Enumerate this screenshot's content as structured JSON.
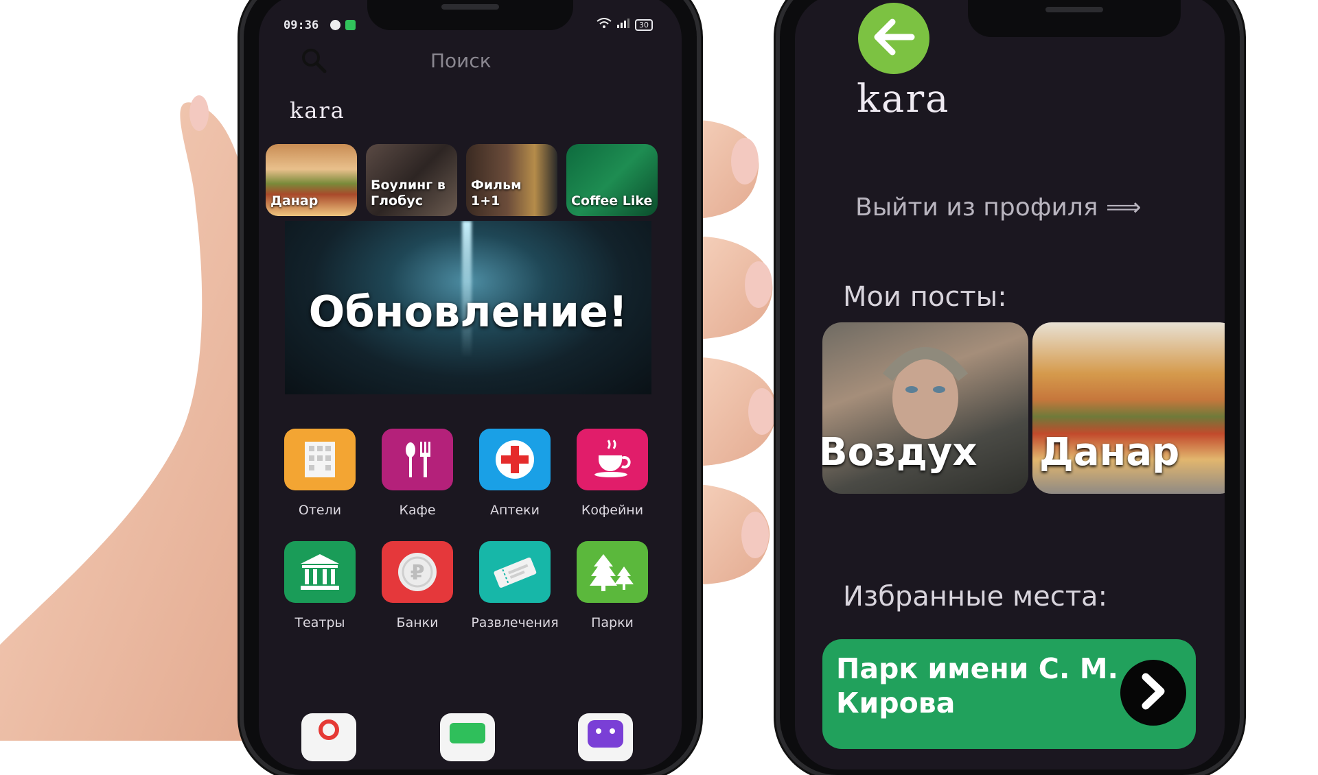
{
  "phone1": {
    "status_bar": {
      "time": "09:36",
      "battery": "30"
    },
    "search": {
      "placeholder": "Поиск"
    },
    "app_logo": "kara",
    "stories": [
      {
        "label": "Данар"
      },
      {
        "label": "Боулинг в Глобус"
      },
      {
        "label": "Фильм 1+1"
      },
      {
        "label": "Coffee Like"
      }
    ],
    "banner": {
      "title": "Обновление!"
    },
    "categories": [
      {
        "label": "Отели",
        "icon": "hotel-icon",
        "color": "#f3a533"
      },
      {
        "label": "Кафе",
        "icon": "cutlery-icon",
        "color": "#b4217a"
      },
      {
        "label": "Аптеки",
        "icon": "pharmacy-cross-icon",
        "color": "#1aa0e6"
      },
      {
        "label": "Кофейни",
        "icon": "coffee-cup-icon",
        "color": "#e11d6a"
      },
      {
        "label": "Театры",
        "icon": "theater-building-icon",
        "color": "#1a9c58"
      },
      {
        "label": "Банки",
        "icon": "ruble-coin-icon",
        "color": "#e5383b"
      },
      {
        "label": "Развлечения",
        "icon": "ticket-icon",
        "color": "#17b7a8"
      },
      {
        "label": "Парки",
        "icon": "trees-icon",
        "color": "#5bb83c"
      }
    ]
  },
  "phone2": {
    "app_logo": "kara",
    "logout": "Выйти из профиля ⟹",
    "my_posts_title": "Мои посты:",
    "posts": [
      {
        "label": "Воздух"
      },
      {
        "label": "Данар"
      }
    ],
    "favorites_title": "Избранные места:",
    "favorite_place": "Парк имени С. М. Кирова",
    "colors": {
      "back_button": "#7cc242",
      "favorite_card": "#21a15c",
      "screen_bg": "#1b1720"
    }
  }
}
